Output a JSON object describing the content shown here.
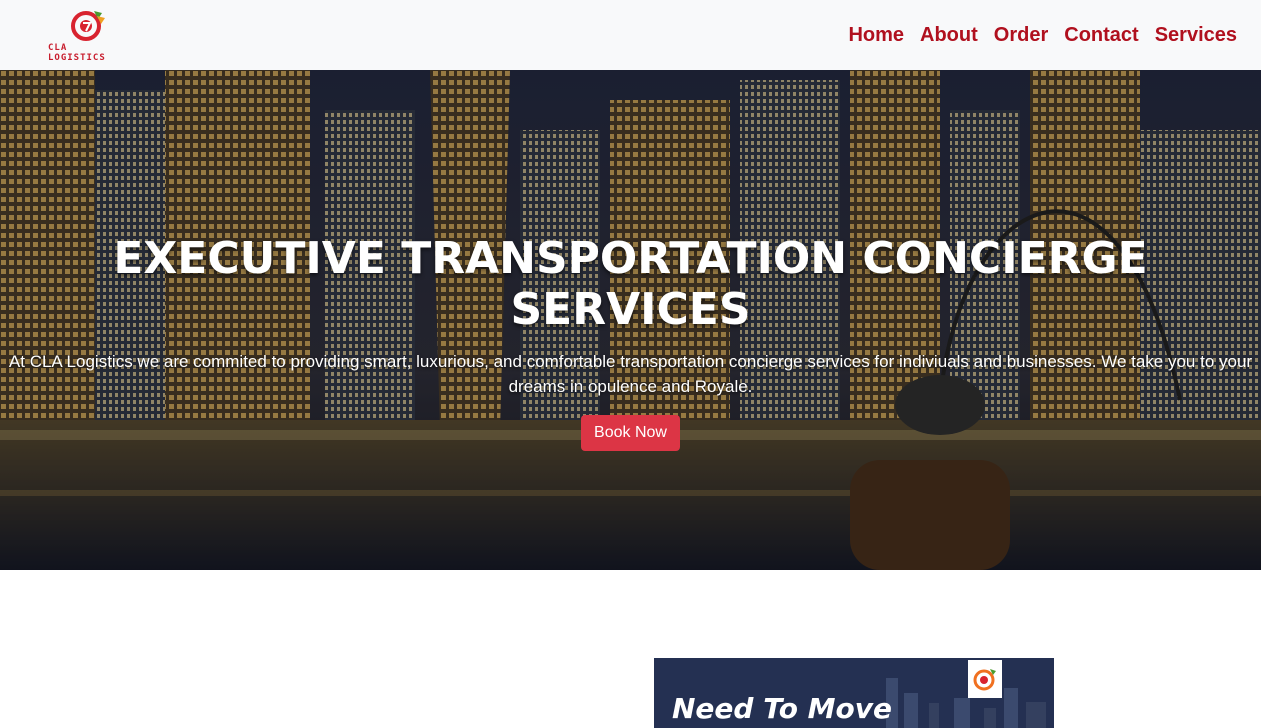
{
  "brand": {
    "name": "CLA LOGISTICS",
    "accent": "#c81e2e"
  },
  "nav": {
    "items": [
      {
        "label": "Home"
      },
      {
        "label": "About"
      },
      {
        "label": "Order"
      },
      {
        "label": "Contact"
      },
      {
        "label": "Services"
      }
    ]
  },
  "hero": {
    "title": "EXECUTIVE TRANSPORTATION CONCIERGE SERVICES",
    "text": "At CLA Logistics we are commited to providing smart, luxurious, and comfortable transportation concierge services for indiviuals and businesses. We take you to your dreams in opulence and Royale.",
    "button": "Book Now",
    "button_color": "#dc3545"
  },
  "promo": {
    "title": "Need To Move"
  }
}
